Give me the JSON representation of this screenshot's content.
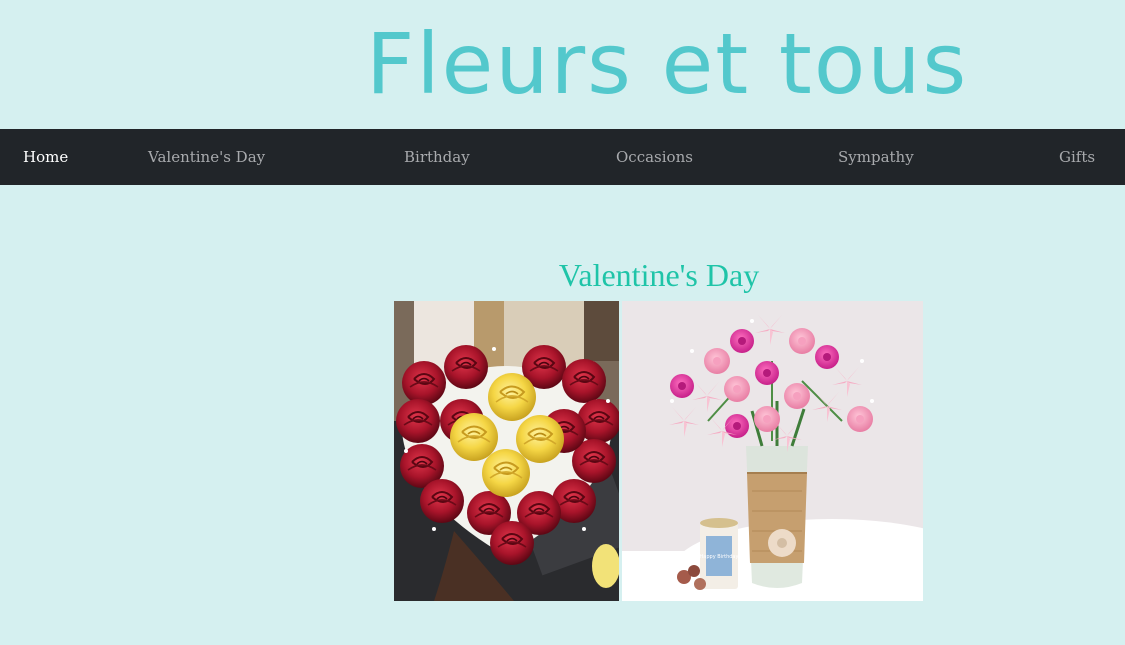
{
  "header": {
    "site_title": "Fleurs et tous"
  },
  "nav": {
    "items": [
      {
        "label": "Home",
        "active": true
      },
      {
        "label": "Valentine's Day",
        "active": false
      },
      {
        "label": "Birthday",
        "active": false
      },
      {
        "label": "Occasions",
        "active": false
      },
      {
        "label": "Sympathy",
        "active": false
      },
      {
        "label": "Gifts",
        "active": false
      }
    ]
  },
  "main": {
    "section_title": "Valentine's Day",
    "images": [
      {
        "name": "rose-heart-bouquet-image",
        "subject": "heart-shaped bouquet of red and yellow roses"
      },
      {
        "name": "pink-flower-vase-image",
        "subject": "pink carnations and lilies in a jute-wrapped vase with a gift tin and chocolates"
      }
    ],
    "gift_tin_text": "Happy Birthday"
  },
  "colors": {
    "background": "#d5f0f0",
    "title": "#53c8cc",
    "navbar": "#212529",
    "nav_active": "#ffffff",
    "nav_inactive": "#a8aaad",
    "section_title": "#1fc4a8"
  }
}
